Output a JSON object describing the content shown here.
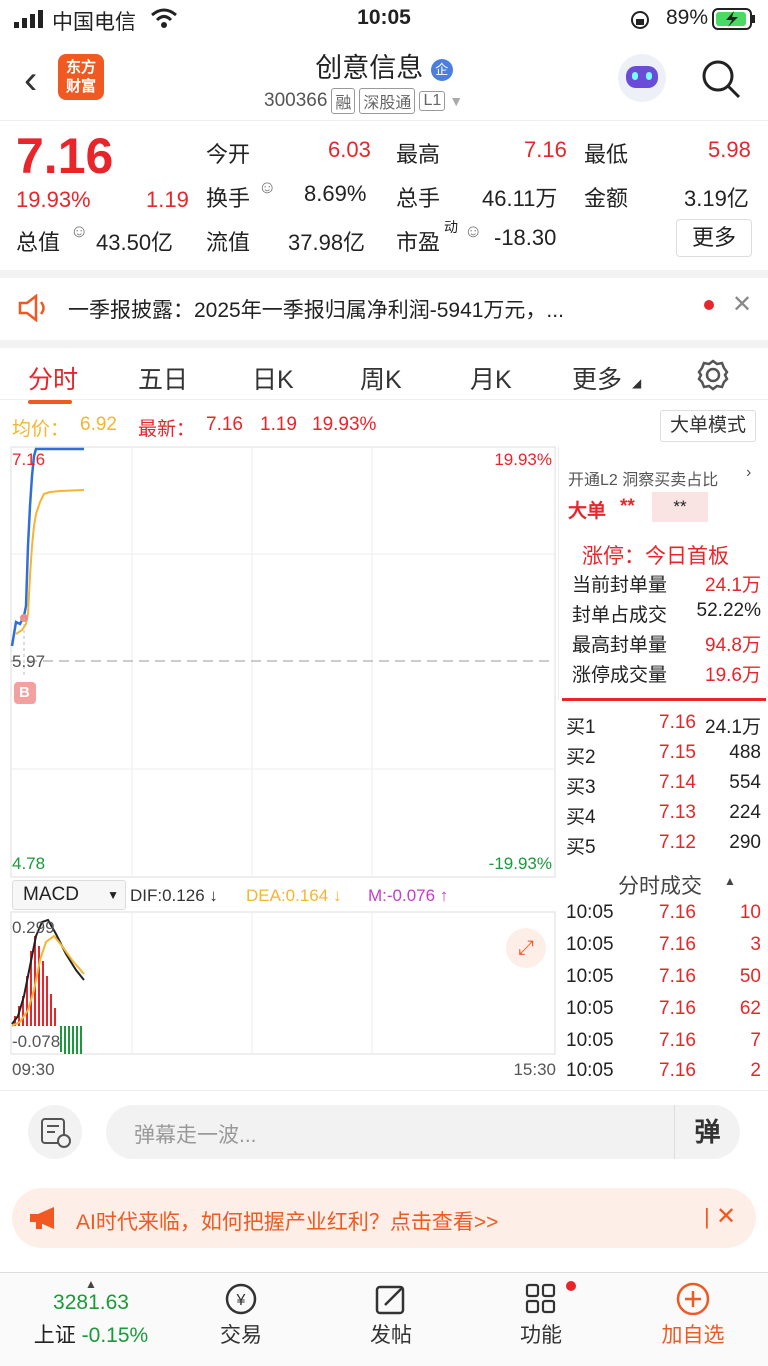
{
  "status": {
    "carrier": "中国电信",
    "time": "10:05",
    "battery": "89%"
  },
  "header": {
    "logo_line1": "东方",
    "logo_line2": "财富",
    "name": "创意信息",
    "badge": "企",
    "code": "300366",
    "tags": [
      "融",
      "深股通",
      "L1"
    ]
  },
  "quote": {
    "price": "7.16",
    "change_pct": "19.93%",
    "change": "1.19",
    "open_label": "今开",
    "open": "6.03",
    "high_label": "最高",
    "high": "7.16",
    "low_label": "最低",
    "low": "5.98",
    "turnover_label": "换手",
    "turnover": "8.69%",
    "vol_label": "总手",
    "vol": "46.11万",
    "amount_label": "金额",
    "amount": "3.19亿",
    "mktcap_label": "总值",
    "mktcap": "43.50亿",
    "float_label": "流值",
    "float": "37.98亿",
    "pe_label": "市盈",
    "pe_sup": "动",
    "pe": "-18.30",
    "more": "更多"
  },
  "notice": {
    "text": "一季报披露：2025年一季报归属净利润-5941万元，..."
  },
  "tabs": [
    "分时",
    "五日",
    "日K",
    "周K",
    "月K",
    "更多"
  ],
  "avgline": {
    "avg_label": "均价：",
    "avg": "6.92",
    "latest_label": "最新：",
    "latest": "7.16",
    "change": "1.19",
    "pct": "19.93%",
    "mode_btn": "大单模式"
  },
  "chart": {
    "y_top": "7.16",
    "y_mid": "5.97",
    "y_bot": "4.78",
    "pct_top": "19.93%",
    "pct_bot": "-19.93%",
    "macd_label": "MACD",
    "dif": "DIF:0.126 ↓",
    "dea": "DEA:0.164 ↓",
    "m": "M:-0.076 ↑",
    "macd_top": "0.299",
    "macd_bot": "-0.078",
    "time_start": "09:30",
    "time_end": "15:30",
    "b_marker": "B"
  },
  "right": {
    "l2": "开通L2 洞察买卖占比",
    "big_label": "大单",
    "big_v1": "**",
    "big_v2": "**",
    "limit_title": "涨停：今日首板",
    "rows": [
      {
        "label": "当前封单量",
        "value": "24.1万"
      },
      {
        "label": "封单占成交",
        "value": "52.22%"
      },
      {
        "label": "最高封单量",
        "value": "94.8万"
      },
      {
        "label": "涨停成交量",
        "value": "19.6万"
      }
    ],
    "bids": [
      {
        "label": "买1",
        "price": "7.16",
        "vol": "24.1万"
      },
      {
        "label": "买2",
        "price": "7.15",
        "vol": "488"
      },
      {
        "label": "买3",
        "price": "7.14",
        "vol": "554"
      },
      {
        "label": "买4",
        "price": "7.13",
        "vol": "224"
      },
      {
        "label": "买5",
        "price": "7.12",
        "vol": "290"
      }
    ],
    "trades_title": "分时成交",
    "trades": [
      {
        "time": "10:05",
        "price": "7.16",
        "vol": "10"
      },
      {
        "time": "10:05",
        "price": "7.16",
        "vol": "3"
      },
      {
        "time": "10:05",
        "price": "7.16",
        "vol": "50"
      },
      {
        "time": "10:05",
        "price": "7.16",
        "vol": "62"
      },
      {
        "time": "10:05",
        "price": "7.16",
        "vol": "7"
      },
      {
        "time": "10:05",
        "price": "7.16",
        "vol": "2"
      }
    ]
  },
  "comment": {
    "placeholder": "弹幕走一波...",
    "btn": "弹"
  },
  "ad": {
    "text": "AI时代来临，如何把握产业红利？点击查看>>"
  },
  "bottom": {
    "index_value": "3281.63",
    "index_name": "上证",
    "index_change": "-0.15%",
    "items": [
      "交易",
      "发帖",
      "功能",
      "加自选"
    ]
  }
}
